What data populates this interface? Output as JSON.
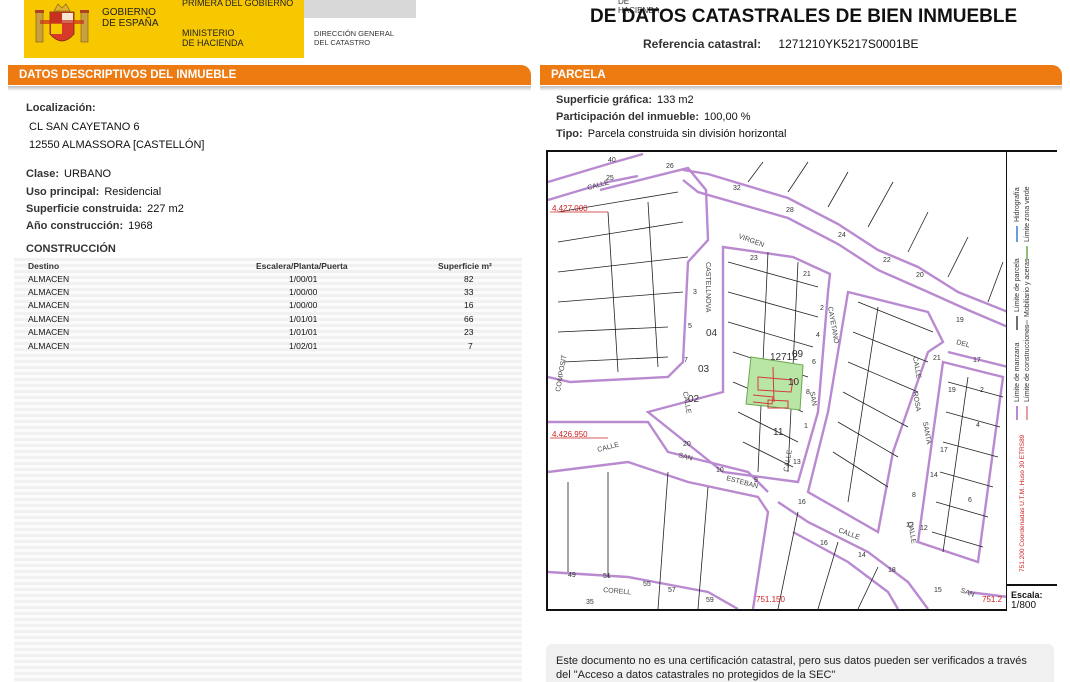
{
  "header": {
    "gobierno": "GOBIERNO\nDE ESPAÑA",
    "secretaria": "PRIMERA DEL GOBIERNO",
    "ministerio": "MINISTERIO\nDE HACIENDA",
    "hacienda": "DE HACIENDA",
    "direccion": "DIRECCIÓN GENERAL\nDEL CATASTRO",
    "title": "DE DATOS CATASTRALES DE BIEN INMUEBLE",
    "ref_label": "Referencia catastral:",
    "ref_value": "1271210YK5217S0001BE"
  },
  "left": {
    "section_title": "DATOS DESCRIPTIVOS DEL INMUEBLE",
    "localizacion_label": "Localización:",
    "address_line1": "CL SAN CAYETANO 6",
    "address_line2": "12550 ALMASSORA [CASTELLÓN]",
    "clase_label": "Clase:",
    "clase_value": "URBANO",
    "uso_label": "Uso principal:",
    "uso_value": "Residencial",
    "sup_label": "Superficie construida:",
    "sup_value": "227 m2",
    "anio_label": "Año construcción:",
    "anio_value": "1968",
    "construccion_title": "CONSTRUCCIÓN",
    "table": {
      "headers": [
        "Destino",
        "Escalera/Planta/Puerta",
        "Superficie m²"
      ],
      "rows": [
        [
          "ALMACEN",
          "1/00/01",
          "82"
        ],
        [
          "ALMACEN",
          "1/00/00",
          "33"
        ],
        [
          "ALMACEN",
          "1/00/00",
          "16"
        ],
        [
          "ALMACEN",
          "1/01/01",
          "66"
        ],
        [
          "ALMACEN",
          "1/01/01",
          "23"
        ],
        [
          "ALMACEN",
          "1/02/01",
          "7"
        ]
      ]
    }
  },
  "right": {
    "section_title": "PARCELA",
    "sup_grafica_label": "Superficie gráfica:",
    "sup_grafica_value": "133 m2",
    "participacion_label": "Participación del inmueble:",
    "participacion_value": "100,00 %",
    "tipo_label": "Tipo:",
    "tipo_value": "Parcela construida sin división horizontal"
  },
  "map": {
    "coord_top": "4.427.000",
    "coord_bottom": "4.426.950",
    "coord_x1": "751.150",
    "coord_x2": "751.2",
    "parcel_ref": "12712",
    "parcel_numbers": [
      "09",
      "10",
      "11",
      "04",
      "03",
      "02"
    ],
    "street_names": [
      "VIRGEN",
      "CALLE",
      "CASTELLNOVA",
      "CALLE",
      "SAN",
      "CAYETANO",
      "CALLE",
      "SAN",
      "ESTEBAN",
      "CALLE",
      "SANTA",
      "ROSA",
      "CALLE",
      "SAN",
      "CORELL",
      "DEL",
      "CALLE",
      "COMPOSIT",
      "CALLE"
    ],
    "number_labels": [
      "40",
      "26",
      "25",
      "32",
      "28",
      "24",
      "22",
      "20",
      "23",
      "21",
      "19",
      "17",
      "10",
      "14",
      "12",
      "3",
      "5",
      "7",
      "2",
      "4",
      "6",
      "8",
      "1",
      "9",
      "13",
      "16",
      "18",
      "15",
      "20",
      "21",
      "19",
      "17",
      "49",
      "51",
      "55",
      "57",
      "59",
      "35",
      "16",
      "14",
      "12",
      "8",
      "6",
      "4",
      "2"
    ],
    "legend": {
      "hidrografia": "Hidrografía",
      "zona_verde": "Límite zona verde",
      "parcela": "Límite de parcela",
      "mobiliario": "Mobiliario y aceras",
      "manzana": "Límite de manzana",
      "construcciones": "Límite de construcciones",
      "coords": "751.200 Coordenadas U.T.M. Huso 30 ETRS89"
    },
    "scale_label": "Escala:",
    "scale_value": "1/800"
  },
  "note": "Este documento no es una certificación catastral, pero sus datos pueden ser verificados a través del \"Acceso a datos catastrales no protegidos de la SEC\"",
  "colors": {
    "orange": "#ee7a12",
    "yellow": "#f7c700",
    "purple": "#b98ad0",
    "parcel_green": "#b9e6a4",
    "coord_red": "#cc2222"
  }
}
